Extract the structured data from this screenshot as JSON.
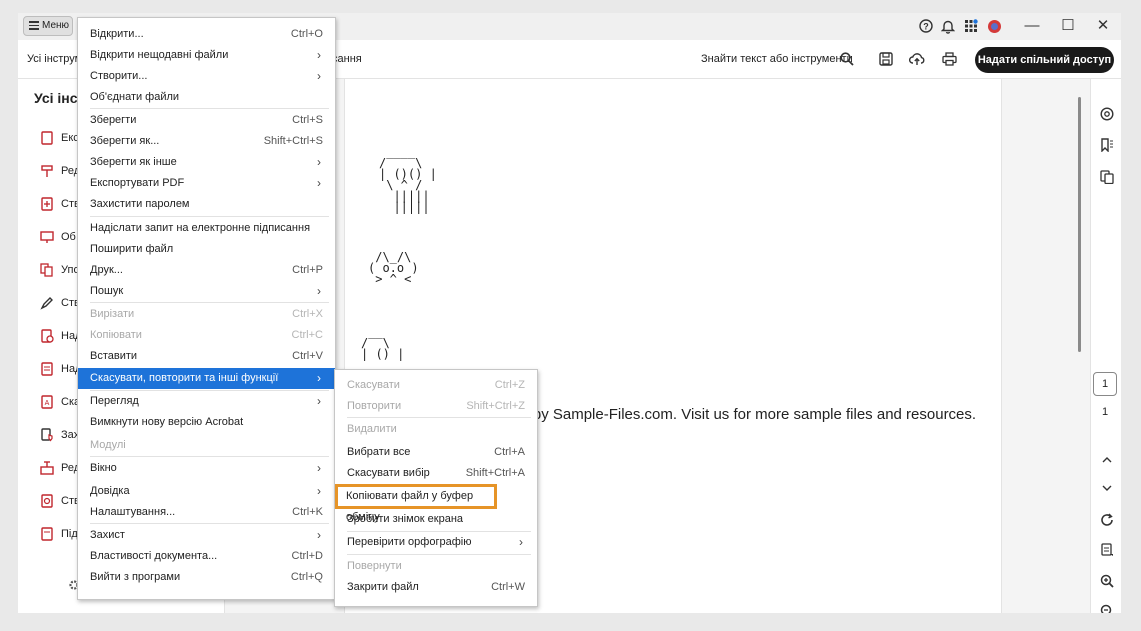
{
  "titlebar": {
    "menu_label": "Меню",
    "icons": [
      "help-icon",
      "bell-icon",
      "apps-icon",
      "profile-icon"
    ],
    "window_controls": [
      "—",
      "☐",
      "✕"
    ]
  },
  "toolbar": {
    "tab_all_tools": "Усі інструм",
    "tab_sign_fragment": "сання",
    "find_text": "Знайти текст або інструменти",
    "share_label": "Надати спільний доступ"
  },
  "left_panel": {
    "title": "Усі інстр",
    "tools": [
      "Екс",
      "Ред",
      "Ств",
      "Об",
      "Упо",
      "Ств",
      "Над",
      "Над",
      "Ска",
      "Зах",
      "Ред",
      "Ств",
      "Під"
    ]
  },
  "document": {
    "ascii_skull": " ____\n/    \\\n| ()() |\n \\ ^ /\n  ||||| \n  ||||| ",
    "ascii_cat": " /\\_/\\\n( o.o )\n > ^ <",
    "ascii_partial": " __\n/  \\\n| () |",
    "text": "ed by Sample-Files.com. Visit us for more sample files and resources."
  },
  "right_panel": {
    "current_page": "1",
    "total_pages": "1"
  },
  "main_menu": [
    {
      "label": "Відкрити...",
      "shortcut": "Ctrl+O"
    },
    {
      "label": "Відкрити нещодавні файли",
      "submenu": true
    },
    {
      "label": "Створити...",
      "submenu": true
    },
    {
      "label": "Об'єднати файли"
    },
    {
      "label": "Зберегти",
      "shortcut": "Ctrl+S"
    },
    {
      "label": "Зберегти як...",
      "shortcut": "Shift+Ctrl+S"
    },
    {
      "label": "Зберегти як інше",
      "submenu": true
    },
    {
      "label": "Експортувати PDF",
      "submenu": true
    },
    {
      "label": "Захистити паролем"
    },
    {
      "label": "Надіслати запит на електронне підписання"
    },
    {
      "label": "Поширити файл"
    },
    {
      "label": "Друк...",
      "shortcut": "Ctrl+P"
    },
    {
      "label": "Пошук",
      "submenu": true
    },
    {
      "label": "Вирізати",
      "shortcut": "Ctrl+X",
      "disabled": true
    },
    {
      "label": "Копіювати",
      "shortcut": "Ctrl+C",
      "disabled": true
    },
    {
      "label": "Вставити",
      "shortcut": "Ctrl+V"
    },
    {
      "label": "Скасувати, повторити та інші функції",
      "submenu": true,
      "highlighted": true
    },
    {
      "label": "Перегляд",
      "submenu": true
    },
    {
      "label": "Вимкнути нову версію Acrobat"
    },
    {
      "label": "Модулі",
      "disabled": true
    },
    {
      "label": "Вікно",
      "submenu": true
    },
    {
      "label": "Довідка",
      "submenu": true
    },
    {
      "label": "Налаштування...",
      "shortcut": "Ctrl+K"
    },
    {
      "label": "Захист",
      "submenu": true
    },
    {
      "label": "Властивості документа...",
      "shortcut": "Ctrl+D"
    },
    {
      "label": "Вийти з програми",
      "shortcut": "Ctrl+Q"
    }
  ],
  "sub_menu": [
    {
      "label": "Скасувати",
      "shortcut": "Ctrl+Z",
      "disabled": true
    },
    {
      "label": "Повторити",
      "shortcut": "Shift+Ctrl+Z",
      "disabled": true
    },
    {
      "label": "Видалити",
      "disabled": true
    },
    {
      "label": "Вибрати все",
      "shortcut": "Ctrl+A"
    },
    {
      "label": "Скасувати вибір",
      "shortcut": "Shift+Ctrl+A"
    },
    {
      "label": "Копіювати файл у буфер обміну",
      "boxed": true
    },
    {
      "label": "Зробити знімок екрана"
    },
    {
      "label": "Перевірити орфографію",
      "submenu": true
    },
    {
      "label": "Повернути",
      "disabled": true
    },
    {
      "label": "Закрити файл",
      "shortcut": "Ctrl+W"
    }
  ],
  "colors": {
    "highlight": "#1e73d9",
    "box_outline": "#e69428",
    "share_button": "#1a1a1a"
  }
}
